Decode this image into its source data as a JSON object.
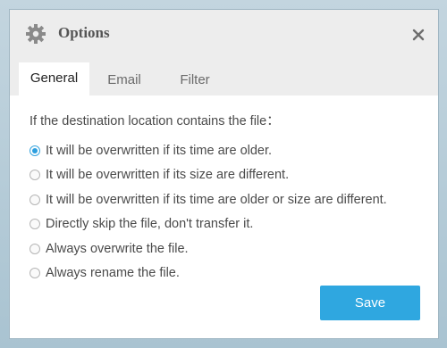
{
  "dialog": {
    "title": "Options",
    "icons": {
      "title_icon": "gear-icon",
      "close_icon": "close-icon"
    }
  },
  "tabs": [
    {
      "label": "General",
      "active": true
    },
    {
      "label": "Email",
      "active": false
    },
    {
      "label": "Filter",
      "active": false
    }
  ],
  "general": {
    "prompt": "If the destination location contains the file：",
    "options": [
      {
        "label": "It will be overwritten if its time are older.",
        "selected": true
      },
      {
        "label": "It will be overwritten if its size are different.",
        "selected": false
      },
      {
        "label": "It will be overwritten if its time are older or size are different.",
        "selected": false
      },
      {
        "label": "Directly skip the file, don't transfer it.",
        "selected": false
      },
      {
        "label": "Always overwrite the file.",
        "selected": false
      },
      {
        "label": "Always rename the file.",
        "selected": false
      }
    ]
  },
  "actions": {
    "save_label": "Save"
  },
  "colors": {
    "accent": "#2fa7e0",
    "titlebar": "#ededed",
    "text": "#4a4a4a"
  }
}
